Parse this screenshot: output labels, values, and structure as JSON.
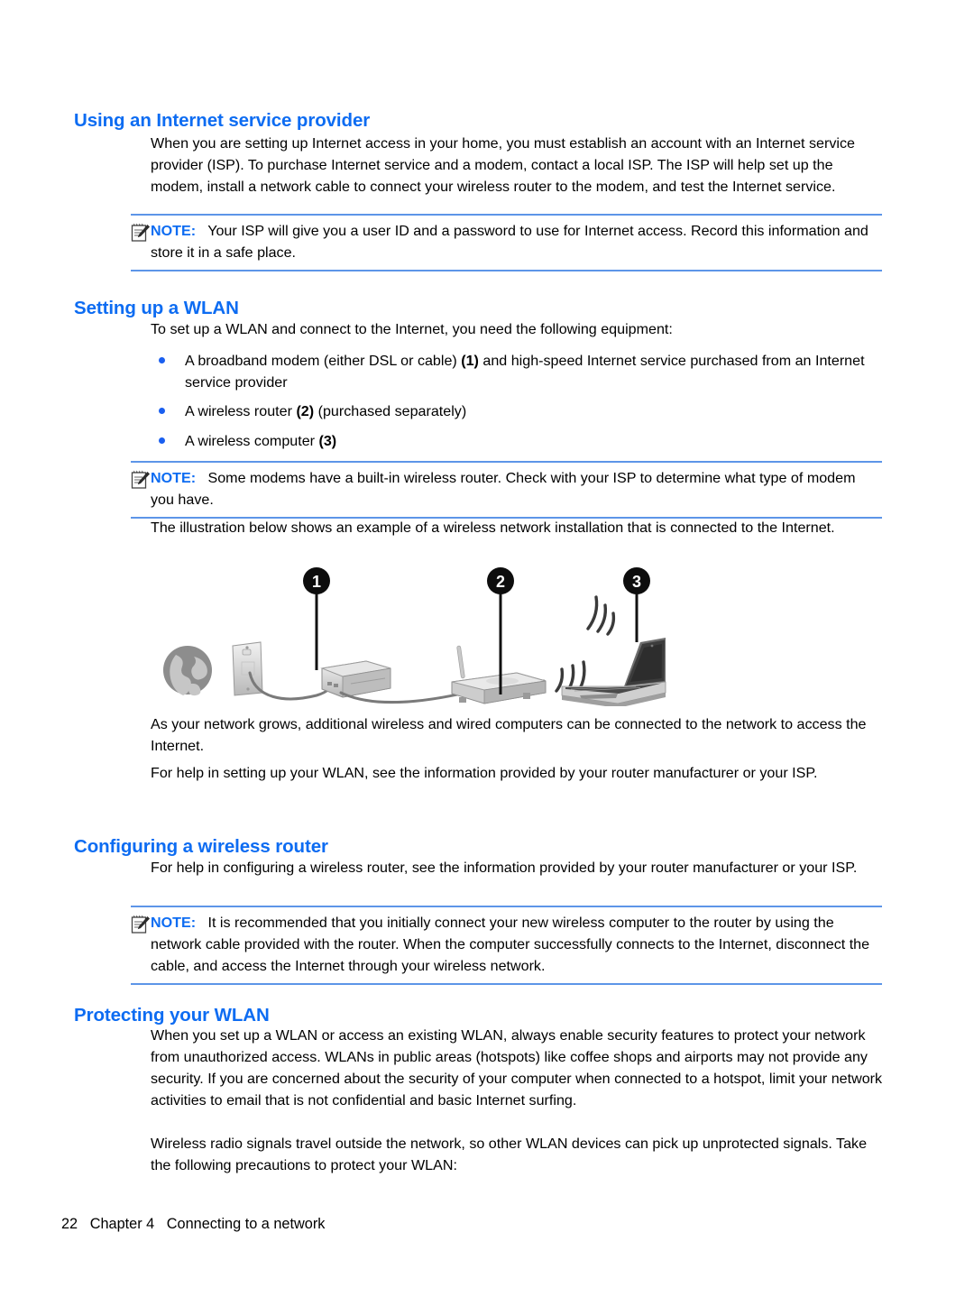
{
  "document": {
    "footer": {
      "page_number": "22",
      "chapter": "Chapter 4",
      "chapter_title": "Connecting to a network"
    }
  },
  "sections": {
    "isp": {
      "heading": "Using an Internet service provider",
      "paragraph": "When you are setting up Internet access in your home, you must establish an account with an Internet service provider (ISP). To purchase Internet service and a modem, contact a local ISP. The ISP will help set up the modem, install a network cable to connect your wireless router to the modem, and test the Internet service.",
      "note": {
        "label": "NOTE:",
        "text": "Your ISP will give you a user ID and a password to use for Internet access. Record this information and store it in a safe place."
      }
    },
    "setting_up_wlan": {
      "heading": "Setting up a WLAN",
      "intro": "To set up a WLAN and connect to the Internet, you need the following equipment:",
      "bullets": [
        {
          "before": "A broadband modem (either DSL or cable) ",
          "ref": "(1)",
          "after": " and high-speed Internet service purchased from an Internet service provider"
        },
        {
          "before": "A wireless router ",
          "ref": "(2)",
          "after": " (purchased separately)"
        },
        {
          "before": "A wireless computer ",
          "ref": "(3)",
          "after": ""
        }
      ],
      "note": {
        "label": "NOTE:",
        "text": "Some modems have a built-in wireless router. Check with your ISP to determine what type of modem you have."
      },
      "illustration_intro": "The illustration below shows an example of a wireless network installation that is connected to the Internet.",
      "illustration": {
        "callouts": [
          "1",
          "2",
          "3"
        ],
        "elements": [
          "globe-icon",
          "wall-jack",
          "broadband-modem",
          "wireless-router",
          "wifi-waves",
          "laptop-computer"
        ]
      },
      "after_illustration_1": "As your network grows, additional wireless and wired computers can be connected to the network to access the Internet.",
      "after_illustration_2": "For help in setting up your WLAN, see the information provided by your router manufacturer or your ISP."
    },
    "configuring_router": {
      "heading": "Configuring a wireless router",
      "paragraph": "For help in configuring a wireless router, see the information provided by your router manufacturer or your ISP.",
      "note": {
        "label": "NOTE:",
        "text": "It is recommended that you initially connect your new wireless computer to the router by using the network cable provided with the router. When the computer successfully connects to the Internet, disconnect the cable, and access the Internet through your wireless network."
      }
    },
    "protecting_wlan": {
      "heading": "Protecting your WLAN",
      "paragraph_1": "When you set up a WLAN or access an existing WLAN, always enable security features to protect your network from unauthorized access. WLANs in public areas (hotspots) like coffee shops and airports may not provide any security. If you are concerned about the security of your computer when connected to a hotspot, limit your network activities to email that is not confidential and basic Internet surfing.",
      "paragraph_2": "Wireless radio signals travel outside the network, so other WLAN devices can pick up unprotected signals. Take the following precautions to protect your WLAN:"
    }
  },
  "colors": {
    "heading_blue": "#0d6cf2",
    "rule_blue": "#5d95e8",
    "bullet_blue": "#1a5ff0",
    "text_black": "#000000"
  }
}
